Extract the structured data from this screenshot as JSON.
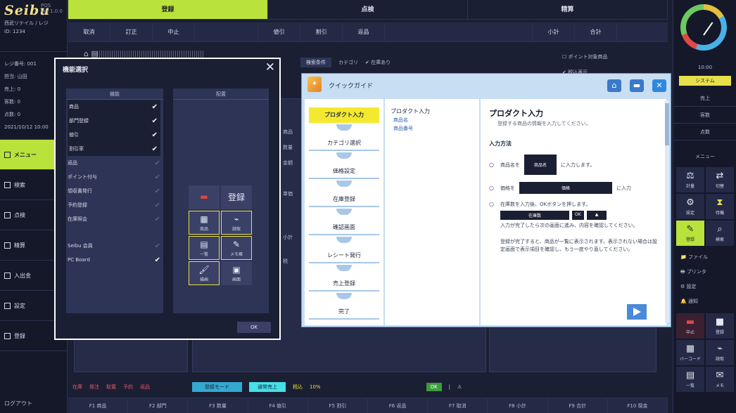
{
  "brand": {
    "logo": "Seibu",
    "version": "POS Ver.1.0.0",
    "subtitle": "西武リテイル / レジ",
    "id": "ID: 1234"
  },
  "left_info": [
    "レジ番号: 001",
    "担当: 山田",
    "売上: 0",
    "客数: 0",
    "点数: 0",
    "2021/10/12 10:00"
  ],
  "left_nav": [
    {
      "label": "メニュー",
      "active": true
    },
    {
      "label": "検索",
      "active": false
    },
    {
      "label": "点検",
      "active": false
    },
    {
      "label": "精算",
      "active": false
    },
    {
      "label": "入出金",
      "active": false
    },
    {
      "label": "設定",
      "active": false
    },
    {
      "label": "登録",
      "active": false
    }
  ],
  "left_bottom": "ログアウト",
  "tabs": [
    {
      "label": "登録",
      "active": true
    },
    {
      "label": "点検",
      "active": false
    },
    {
      "label": "精算",
      "active": false
    }
  ],
  "funcbar": [
    "取消",
    "訂正",
    "中止",
    "",
    "値引",
    "割引",
    "返品",
    "",
    "小計",
    "合計"
  ],
  "main": {
    "toolbar_icons": "⌂ ▤",
    "filter_chip": "検索条件",
    "filter_text_1": "カテゴリ",
    "filter_text_2": "✔ 在庫あり",
    "right_checks": [
      "☐ ポイント対象商品",
      "✔ 税込表示"
    ],
    "frags": [
      "商品",
      "数量",
      "金額",
      "単価",
      "小計",
      "税"
    ]
  },
  "statusbar": {
    "reds": [
      "在庫",
      "発注",
      "取置",
      "予約",
      "返品"
    ],
    "blue": "登録モード",
    "cyan": "通常売上",
    "yellows": [
      "税込",
      "10%"
    ],
    "green": "OK",
    "tail": [
      "|",
      "⚠"
    ]
  },
  "bottombar": [
    "F1 商品",
    "F2 部門",
    "F3 数量",
    "F4 値引",
    "F5 割引",
    "F6 返品",
    "F7 取消",
    "F8 小計",
    "F9 合計",
    "F10 現金"
  ],
  "right": {
    "gauge_label": "10:00",
    "badge": "システム",
    "list": [
      "売上",
      "客数",
      "点数"
    ],
    "section_label": "メニュー",
    "grid1": [
      {
        "glyph": "⚖",
        "label": "計量",
        "style": ""
      },
      {
        "glyph": "⇄",
        "label": "切替",
        "style": ""
      },
      {
        "glyph": "⚙",
        "label": "設定",
        "style": ""
      },
      {
        "glyph": "⧗",
        "label": "待機",
        "style": "yel"
      },
      {
        "glyph": "✎",
        "label": "登録",
        "style": "lime"
      },
      {
        "glyph": "⌕",
        "label": "検索",
        "style": ""
      }
    ],
    "text_list": [
      "📁 ファイル",
      "🖶 プリンタ",
      "⚙ 設定",
      "🔔 通知"
    ],
    "grid2": [
      {
        "glyph": "▬",
        "label": "中止",
        "style": "red"
      },
      {
        "glyph": "■",
        "label": "登録",
        "style": ""
      },
      {
        "glyph": "▦",
        "label": "バーコード",
        "style": ""
      },
      {
        "glyph": "⌁",
        "label": "読取",
        "style": ""
      },
      {
        "glyph": "▤",
        "label": "一覧",
        "style": ""
      },
      {
        "glyph": "✉",
        "label": "メモ",
        "style": ""
      }
    ]
  },
  "dialog1": {
    "title": "機能選択",
    "close": "✕",
    "left_header": "機能",
    "right_header": "配置",
    "items": [
      {
        "label": "商品",
        "checked": true,
        "on": true
      },
      {
        "label": "部門登録",
        "checked": true,
        "on": true
      },
      {
        "label": "値引",
        "checked": true,
        "on": true
      },
      {
        "label": "割引率",
        "checked": true,
        "on": true
      },
      {
        "label": "返品",
        "checked": false,
        "on": false
      },
      {
        "label": "ポイント付与",
        "checked": false,
        "on": false
      },
      {
        "label": "領収書発行",
        "checked": false,
        "on": false
      },
      {
        "label": "予約登録",
        "checked": false,
        "on": false
      },
      {
        "label": "在庫照会",
        "checked": false,
        "on": false
      }
    ],
    "items_extra": [
      {
        "label": "Seibu 会員",
        "checked": false
      },
      {
        "label": "PC Board",
        "checked": true
      }
    ],
    "icons": [
      {
        "glyph": "▬",
        "label": "",
        "style": "red"
      },
      {
        "glyph": "登録",
        "label": "",
        "style": "yel"
      },
      {
        "glyph": "▦",
        "label": "商品",
        "style": "hl"
      },
      {
        "glyph": "⌁",
        "label": "読取",
        "style": "hl"
      },
      {
        "glyph": "▤",
        "label": "一覧",
        "style": "hl"
      },
      {
        "glyph": "✎",
        "label": "メモ帳",
        "style": "hl"
      },
      {
        "glyph": "🖌",
        "label": "描画",
        "style": "hl"
      },
      {
        "glyph": "▣",
        "label": "画面",
        "style": ""
      }
    ],
    "ok": "OK"
  },
  "dialog2": {
    "logo": "✦",
    "title": "クイックガイド",
    "steps": [
      "プロダクト入力",
      "カテゴリ選択",
      "価格設定",
      "在庫登録",
      "確認画面",
      "レシート発行",
      "売上登録",
      "完了"
    ],
    "mid_a": "プロダクト入力",
    "mid_b": [
      "商品名",
      "商品番号"
    ],
    "heading": "プロダクト入力",
    "subtitle": "登録する商品の情報を入力してください。",
    "section": "入力方法",
    "row1_label": "商品名を",
    "row1_box": "商品名",
    "row1_tail": "に入力します。",
    "row2_label": "価格を",
    "row2_box": "価格",
    "row2_tail": "に入力",
    "row3_text": "在庫数を入力後、OKボタンを押します。",
    "row3_box1": "在庫数",
    "row3_box2": "OK",
    "row3_box3": "▲",
    "row3_para": "入力が完了したら次の画面に進み、内容を確認してください。",
    "para": "登録が完了すると、商品が一覧に表示されます。表示されない場合は設定画面で表示項目を確認し、もう一度やり直してください。"
  }
}
